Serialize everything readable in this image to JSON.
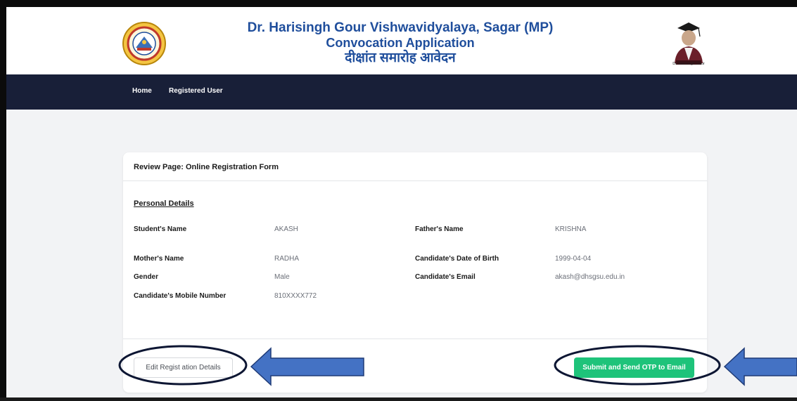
{
  "header": {
    "title_line1": "Dr. Harisingh Gour Vishwavidyalaya, Sagar (MP)",
    "title_line2": "Convocation Application",
    "title_line3": "दीक्षांत समारोह आवेदन",
    "portrait_caption": "Dr. Harisingh Gour"
  },
  "nav": {
    "home": "Home",
    "registered_user": "Registered User"
  },
  "review": {
    "title": "Review Page: Online Registration Form",
    "section_title": "Personal Details",
    "fields": {
      "students_name": {
        "label": "Student's Name",
        "value": "AKASH"
      },
      "fathers_name": {
        "label": "Father's Name",
        "value": "KRISHNA"
      },
      "mothers_name": {
        "label": "Mother's Name",
        "value": "RADHA"
      },
      "date_of_birth": {
        "label": "Candidate's Date of Birth",
        "value": "1999-04-04"
      },
      "gender": {
        "label": "Gender",
        "value": "Male"
      },
      "email": {
        "label": "Candidate's Email",
        "value": "akash@dhsgsu.edu.in"
      },
      "mobile": {
        "label": "Candidate's Mobile Number",
        "value": "810XXXX772"
      }
    }
  },
  "actions": {
    "edit_label": "Edit Regist ation Details",
    "submit_label": "Submit and Send OTP to Email"
  },
  "colors": {
    "title_blue": "#1f4e9c",
    "navbar_bg": "#181f38",
    "submit_green": "#1ec37a",
    "annotation_arrow": "#4472c4",
    "annotation_outline": "#0d1633"
  },
  "icons": {
    "university_logo": "university-emblem-icon",
    "founder_portrait": "founder-portrait-icon",
    "arrow_edit": "arrow-left-icon",
    "arrow_submit": "arrow-left-icon"
  }
}
